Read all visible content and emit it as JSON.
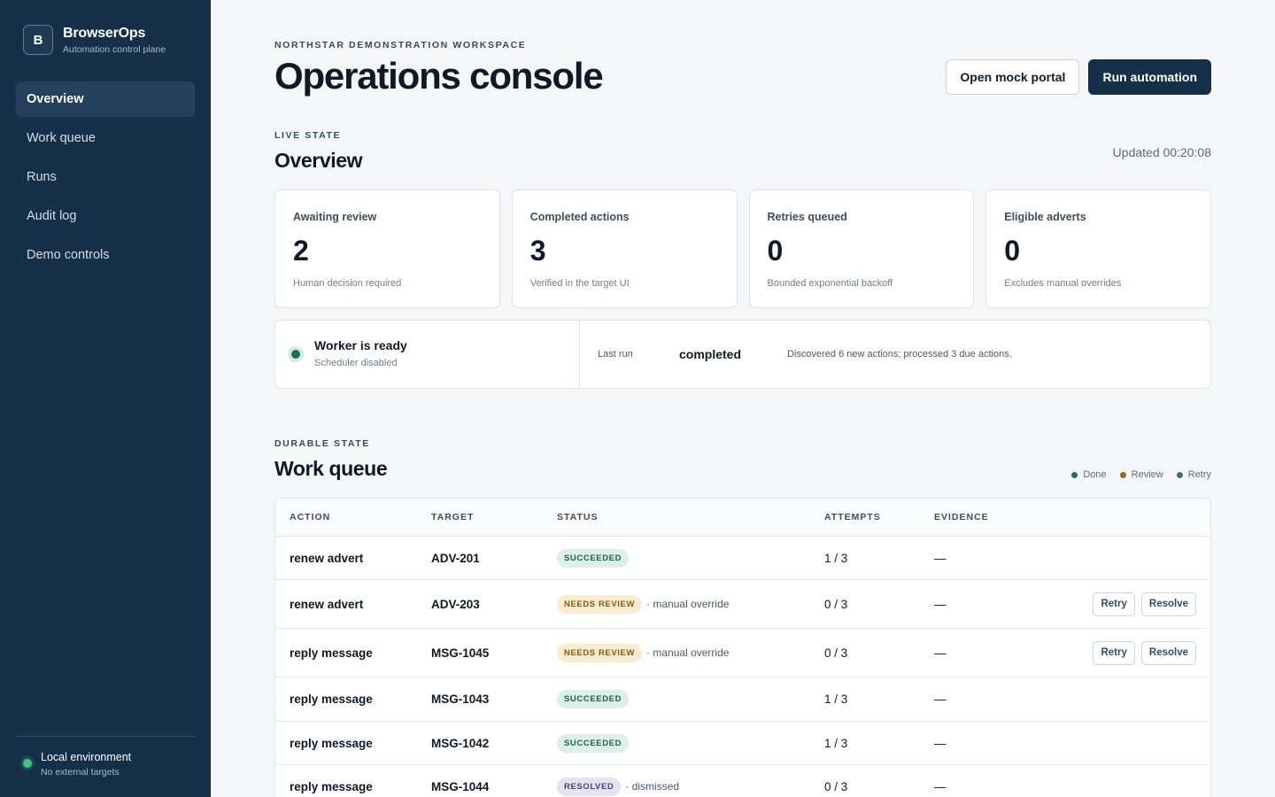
{
  "sidebar": {
    "brand_initial": "B",
    "brand_name": "BrowserOps",
    "brand_sub": "Automation control plane",
    "items": [
      {
        "label": "Overview",
        "active": true
      },
      {
        "label": "Work queue"
      },
      {
        "label": "Runs"
      },
      {
        "label": "Audit log"
      },
      {
        "label": "Demo controls"
      }
    ],
    "env_title": "Local environment",
    "env_sub": "No external targets"
  },
  "header": {
    "eyebrow": "NORTHSTAR DEMONSTRATION WORKSPACE",
    "title": "Operations console",
    "open_portal_label": "Open mock portal",
    "run_label": "Run automation"
  },
  "overview": {
    "eyebrow": "LIVE STATE",
    "title": "Overview",
    "updated": "Updated 00:20:08",
    "metrics": [
      {
        "label": "Awaiting review",
        "value": "2",
        "sub": "Human decision required"
      },
      {
        "label": "Completed actions",
        "value": "3",
        "sub": "Verified in the target UI"
      },
      {
        "label": "Retries queued",
        "value": "0",
        "sub": "Bounded exponential backoff"
      },
      {
        "label": "Eligible adverts",
        "value": "0",
        "sub": "Excludes manual overrides"
      }
    ],
    "worker": {
      "title": "Worker is ready",
      "sub": "Scheduler disabled",
      "last_run_label": "Last run",
      "last_run_value": "completed",
      "message": "Discovered 6 new actions; processed 3 due actions."
    }
  },
  "queue": {
    "eyebrow": "DURABLE STATE",
    "title": "Work queue",
    "legend": [
      {
        "label": "Done",
        "color": "#236b5d"
      },
      {
        "label": "Review",
        "color": "#946914"
      },
      {
        "label": "Retry",
        "color": "#3f6e7d"
      }
    ],
    "columns": {
      "action": "ACTION",
      "target": "TARGET",
      "status": "STATUS",
      "attempts": "ATTEMPTS",
      "evidence": "EVIDENCE"
    },
    "retry_label": "Retry",
    "resolve_label": "Resolve",
    "rows": [
      {
        "action": "renew advert",
        "target": "ADV-201",
        "status": "SUCCEEDED",
        "kind": "succeeded",
        "note": "",
        "attempts": "1 / 3",
        "evidence": "—",
        "actions": false
      },
      {
        "action": "renew advert",
        "target": "ADV-203",
        "status": "NEEDS REVIEW",
        "kind": "review",
        "note": "· manual override",
        "attempts": "0 / 3",
        "evidence": "—",
        "actions": true
      },
      {
        "action": "reply message",
        "target": "MSG-1045",
        "status": "NEEDS REVIEW",
        "kind": "review",
        "note": "· manual override",
        "attempts": "0 / 3",
        "evidence": "—",
        "actions": true
      },
      {
        "action": "reply message",
        "target": "MSG-1043",
        "status": "SUCCEEDED",
        "kind": "succeeded",
        "note": "",
        "attempts": "1 / 3",
        "evidence": "—",
        "actions": false
      },
      {
        "action": "reply message",
        "target": "MSG-1042",
        "status": "SUCCEEDED",
        "kind": "succeeded",
        "note": "",
        "attempts": "1 / 3",
        "evidence": "—",
        "actions": false
      },
      {
        "action": "reply message",
        "target": "MSG-1044",
        "status": "RESOLVED",
        "kind": "resolved",
        "note": "· dismissed",
        "attempts": "0 / 3",
        "evidence": "—",
        "actions": false
      }
    ]
  }
}
